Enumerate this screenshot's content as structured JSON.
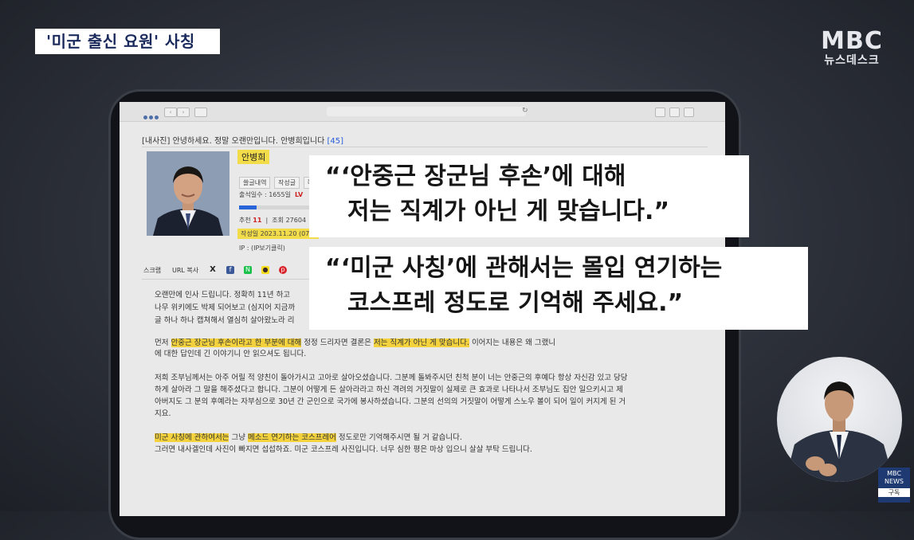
{
  "caption": {
    "tag": "'미군 출신 요원' 사칭"
  },
  "logo": {
    "line1": "MBC",
    "line2": "뉴스데스크"
  },
  "post": {
    "title": "[내사진] 안녕하세요. 정말 오랜만입니다. 안병희입니다",
    "comment_count": "[45]",
    "author": "안병희",
    "stat_buttons": [
      "쓸글내역",
      "작성글",
      "쪽지"
    ],
    "attendance": "출석일수 : 1655일",
    "attendance_extra": "LV",
    "recommend_label": "추천",
    "recommend": "11",
    "views_label": "조회",
    "views": "27604",
    "views_extra": "L",
    "date": "작성일 2023.11.20 (07:2",
    "ip": "IP : (IP보기클릭)",
    "share": {
      "scrap": "스크랩",
      "url": "URL 복사",
      "x": "X",
      "fb": "f",
      "n": "N",
      "ka": "●",
      "p": "p"
    }
  },
  "body": {
    "p1": [
      "오랜만에 인사 드립니다. 정확히 11년 하고",
      "나무 위키에도 박제 되어보고 (심지어 지금까",
      "글 하나 하나 캡쳐해서 열심히 살아왔노라 리"
    ],
    "p2_pre": "먼저 ",
    "p2_hl1": "안중근 장군님 후손이라고 한 부분에 대해",
    "p2_mid": " 정정 드리자면 결론은 ",
    "p2_hl2": "저는 직계가 아닌 게 맞습니다.",
    "p2_post": " 이어지는 내용은 왜 그랬니",
    "p2_line2": "에 대한 답인데 긴 이야기니 안 읽으셔도 됩니다.",
    "p3": [
      "저희 조부님께서는 아주 어릴 적 양친이 돌아가시고 고아로 살아오셨습니다. 그분께 돌봐주시던 친척 분이 너는 안중근의 후예다 항상 자신감 있고 당당",
      "하게 살아라 그 말을 해주셨다고 합니다. 그분이 어떻게 든 살아라라고 하신 격려의 거짓말이 실제로 큰 효과로 나타나서 조부님도 집안 일으키시고 제",
      "아버지도 그 분의 후예라는 자부심으로 30년 간 군인으로 국가에 봉사하셨습니다. 그분의 선의의 거짓말이 어떻게 스노우 볼이 되어 일이 커지게 된 거",
      "지요."
    ],
    "p4_hl1": "미군 사칭에 관하여서는",
    "p4_mid": " 그냥 ",
    "p4_hl2": "메소드 연기하는 코스프레어",
    "p4_post": " 정도로만 기억해주시면 될 거 같습니다.",
    "p4_line2": "그러면 내사겔인데 사진이 빠지면 섭섭하죠. 미군 코스프레 사진입니다. 너무 심한 평은 마상 입으니 살살 부탁 드립니다."
  },
  "quotes": {
    "q1_line1": "“‘안중근 장군님 후손’에 대해",
    "q1_line2": "저는 직계가 아닌 게 맞습니다.”",
    "q2_line1": "“‘미군 사칭’에 관해서는 몰입 연기하는",
    "q2_line2": "코스프레 정도로 기억해 주세요.”"
  },
  "corner": {
    "brand": "MBC",
    "news": "NEWS",
    "subscribe": "구독"
  }
}
